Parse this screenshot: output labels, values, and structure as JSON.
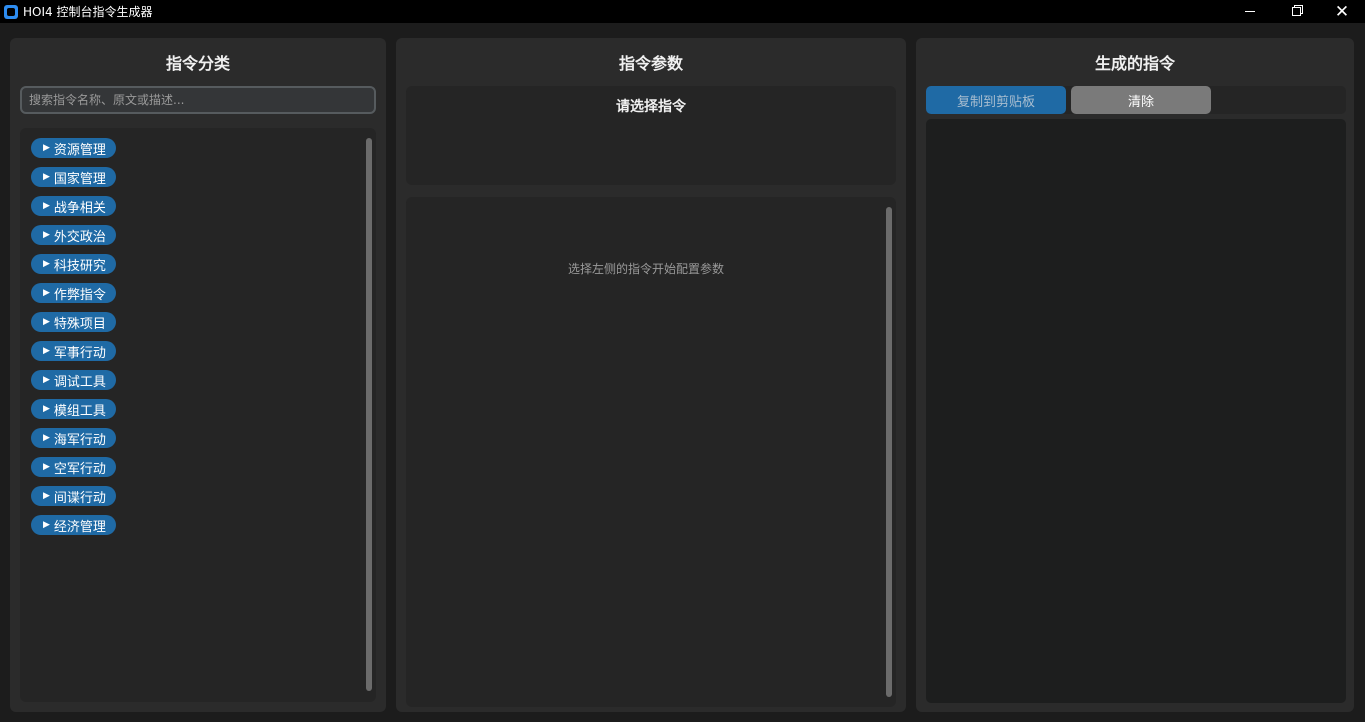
{
  "window": {
    "title": "HOI4 控制台指令生成器",
    "minimize": "—",
    "maximize": "",
    "close": "✕"
  },
  "left_panel": {
    "title": "指令分类",
    "search_placeholder": "搜索指令名称、原文或描述...",
    "categories": [
      {
        "arrow": "▶",
        "label": "资源管理"
      },
      {
        "arrow": "▶",
        "label": "国家管理"
      },
      {
        "arrow": "▶",
        "label": "战争相关"
      },
      {
        "arrow": "▶",
        "label": "外交政治"
      },
      {
        "arrow": "▶",
        "label": "科技研究"
      },
      {
        "arrow": "▶",
        "label": "作弊指令"
      },
      {
        "arrow": "▶",
        "label": "特殊项目"
      },
      {
        "arrow": "▶",
        "label": "军事行动"
      },
      {
        "arrow": "▶",
        "label": "调试工具"
      },
      {
        "arrow": "▶",
        "label": "模组工具"
      },
      {
        "arrow": "▶",
        "label": "海军行动"
      },
      {
        "arrow": "▶",
        "label": "空军行动"
      },
      {
        "arrow": "▶",
        "label": "间谍行动"
      },
      {
        "arrow": "▶",
        "label": "经济管理"
      }
    ]
  },
  "middle_panel": {
    "title": "指令参数",
    "selected_command": "请选择指令",
    "hint": "选择左侧的指令开始配置参数"
  },
  "right_panel": {
    "title": "生成的指令",
    "copy_button": "复制到剪贴板",
    "clear_button": "清除",
    "output": ""
  },
  "colors": {
    "accent": "#1f6aa5",
    "panel_bg": "#2b2b2b",
    "app_bg": "#1c1c1c",
    "clear_button": "#7a7a7a"
  }
}
